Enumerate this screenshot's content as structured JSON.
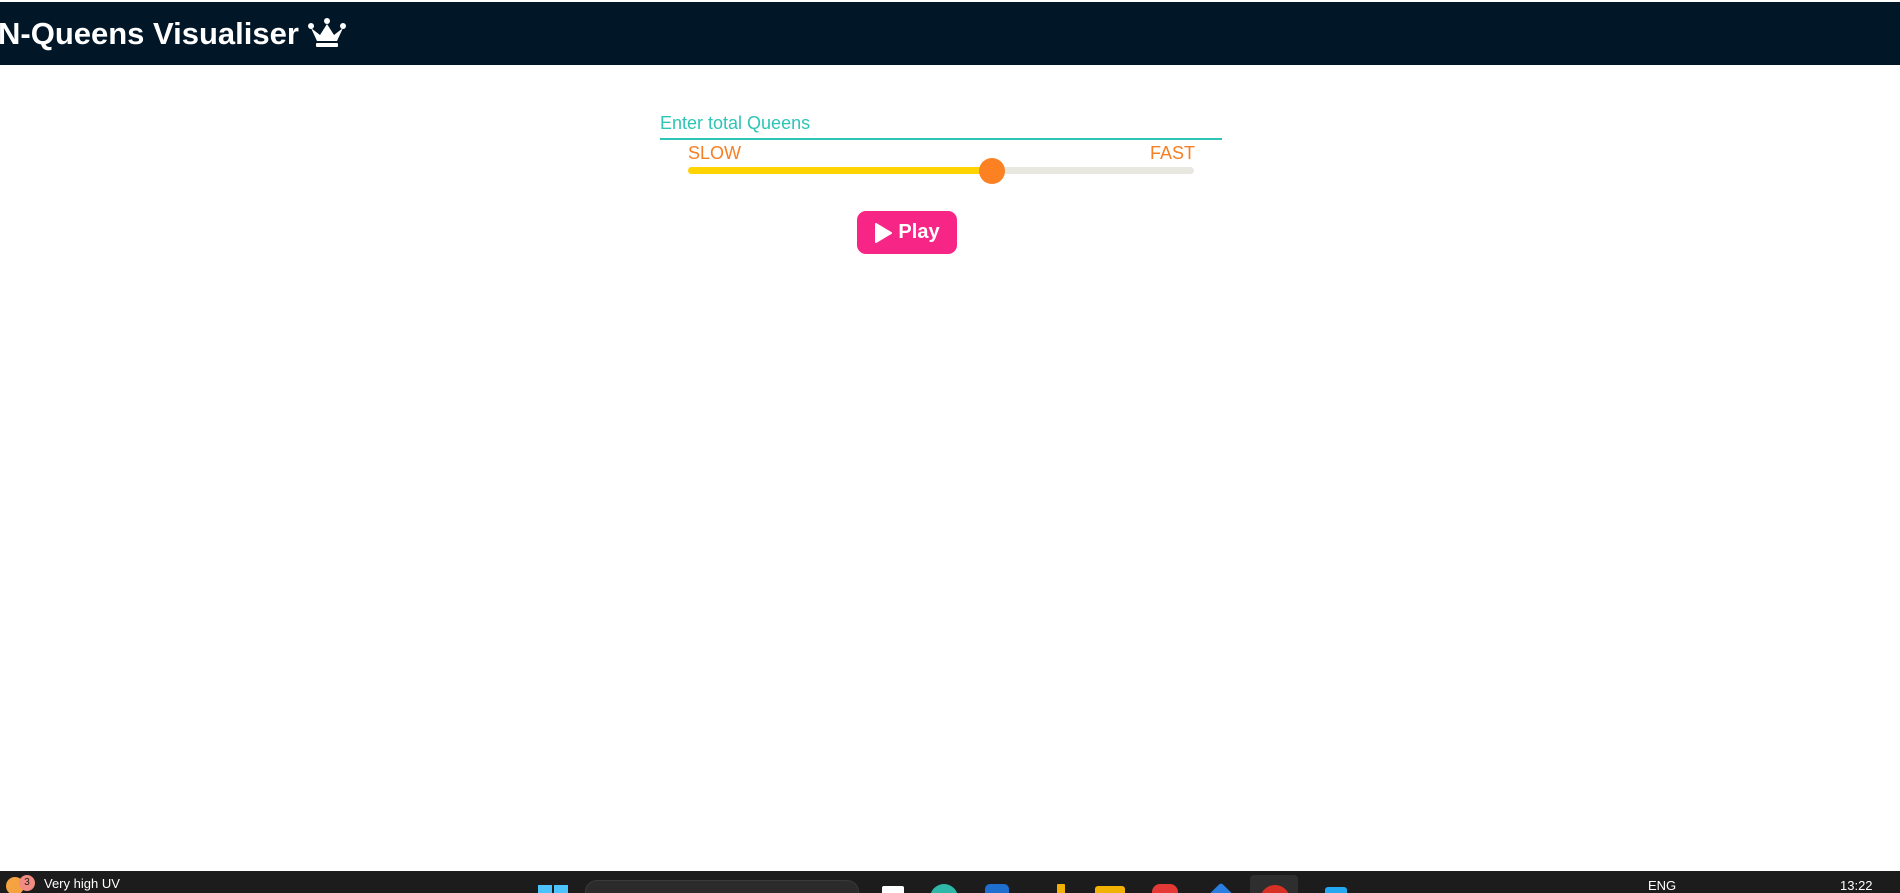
{
  "header": {
    "title": "N-Queens Visualiser",
    "title_icon": "crown-icon",
    "background": "#011627"
  },
  "controls": {
    "queens_input": {
      "placeholder": "Enter total Queens",
      "value": ""
    },
    "speed": {
      "slow_label": "SLOW",
      "fast_label": "FAST",
      "value_fraction": 0.6
    },
    "play_button": {
      "label": "Play",
      "icon": "play-icon"
    }
  },
  "colors": {
    "accent_teal": "#2ec4b6",
    "speed_label": "#f77f23",
    "slider_fill": "#ffd400",
    "slider_thumb": "#fb8122",
    "play_button": "#f72585"
  },
  "taskbar": {
    "weather": {
      "badge": "3",
      "text": "Very high UV"
    },
    "language": "ENG",
    "time": "13:22",
    "icons": [
      "weather-icon",
      "start-icon",
      "search-box",
      "file-explorer-icon",
      "edge-icon",
      "store-icon",
      "folder-icon",
      "chrome-icon",
      "vscode-icon"
    ]
  }
}
